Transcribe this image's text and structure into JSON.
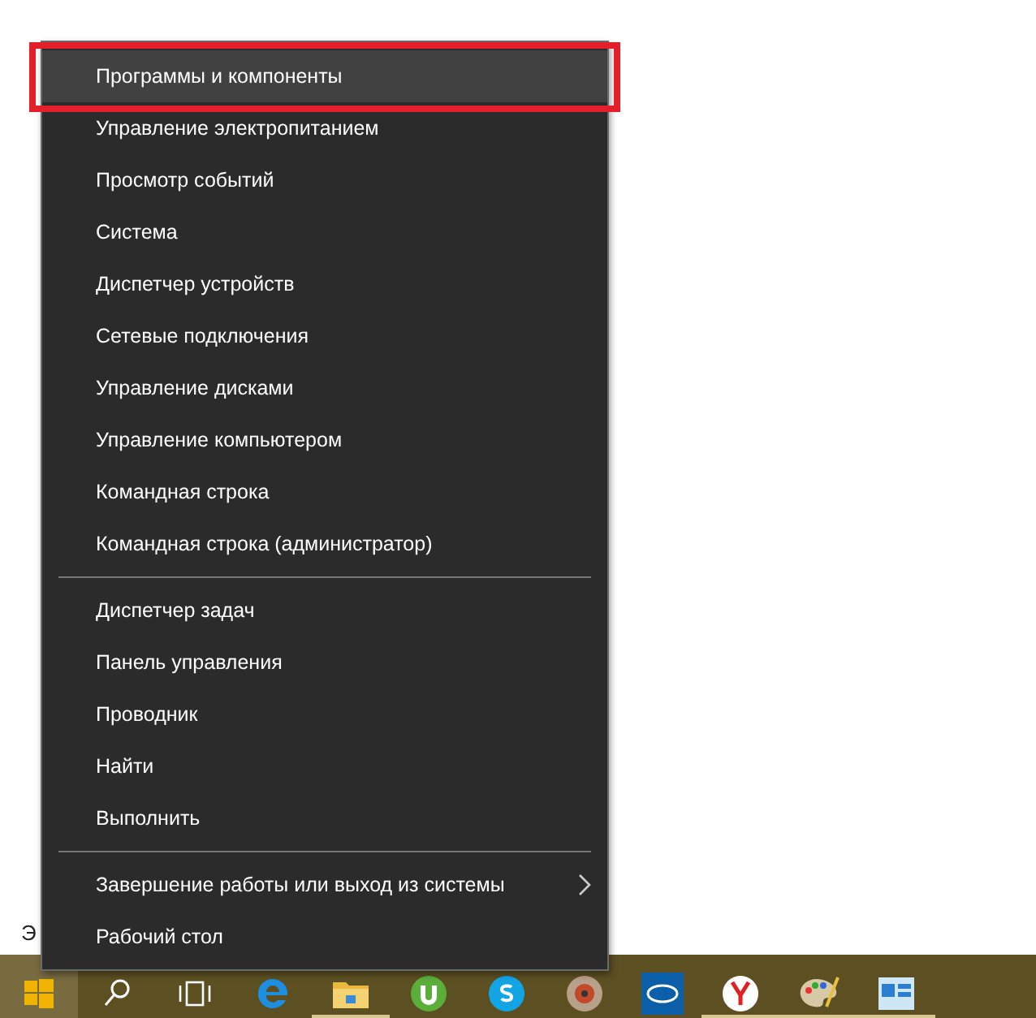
{
  "desktop": {
    "label": "Э"
  },
  "menu": {
    "groups": [
      [
        {
          "label": "Программы и компоненты",
          "kind": "plain",
          "selected": true,
          "annotated": true
        },
        {
          "label": "Управление электропитанием",
          "kind": "plain",
          "selected": false,
          "annotated": false
        },
        {
          "label": "Просмотр событий",
          "kind": "plain",
          "selected": false,
          "annotated": false
        },
        {
          "label": "Система",
          "kind": "plain",
          "selected": false,
          "annotated": false
        },
        {
          "label": "Диспетчер устройств",
          "kind": "plain",
          "selected": false,
          "annotated": false
        },
        {
          "label": "Сетевые подключения",
          "kind": "plain",
          "selected": false,
          "annotated": false
        },
        {
          "label": "Управление дисками",
          "kind": "plain",
          "selected": false,
          "annotated": false
        },
        {
          "label": "Управление компьютером",
          "kind": "plain",
          "selected": false,
          "annotated": false
        },
        {
          "label": "Командная строка",
          "kind": "plain",
          "selected": false,
          "annotated": false
        },
        {
          "label": "Командная строка (администратор)",
          "kind": "plain",
          "selected": false,
          "annotated": false
        }
      ],
      [
        {
          "label": "Диспетчер задач",
          "kind": "plain",
          "selected": false,
          "annotated": false
        },
        {
          "label": "Панель управления",
          "kind": "plain",
          "selected": false,
          "annotated": false
        },
        {
          "label": "Проводник",
          "kind": "plain",
          "selected": false,
          "annotated": false
        },
        {
          "label": "Найти",
          "kind": "plain",
          "selected": false,
          "annotated": false
        },
        {
          "label": "Выполнить",
          "kind": "plain",
          "selected": false,
          "annotated": false
        }
      ],
      [
        {
          "label": "Завершение работы или выход из системы",
          "kind": "submenu",
          "selected": false,
          "annotated": false
        },
        {
          "label": "Рабочий стол",
          "kind": "plain",
          "selected": false,
          "annotated": false
        }
      ]
    ]
  },
  "taskbar": {
    "buttons": [
      {
        "kind": "start",
        "selected": true,
        "running": false
      },
      {
        "kind": "search",
        "selected": false,
        "running": false
      },
      {
        "kind": "taskview",
        "selected": false,
        "running": false
      },
      {
        "kind": "browser-e",
        "selected": false,
        "running": false
      },
      {
        "kind": "folder",
        "selected": false,
        "running": true
      },
      {
        "kind": "torrent",
        "selected": false,
        "running": false
      },
      {
        "kind": "chat-s",
        "selected": false,
        "running": false
      },
      {
        "kind": "disc",
        "selected": false,
        "running": false
      },
      {
        "kind": "chip",
        "selected": false,
        "running": false
      },
      {
        "kind": "browser-y",
        "selected": false,
        "running": true
      },
      {
        "kind": "palette",
        "selected": false,
        "running": true
      },
      {
        "kind": "window-app",
        "selected": false,
        "running": true
      }
    ]
  }
}
